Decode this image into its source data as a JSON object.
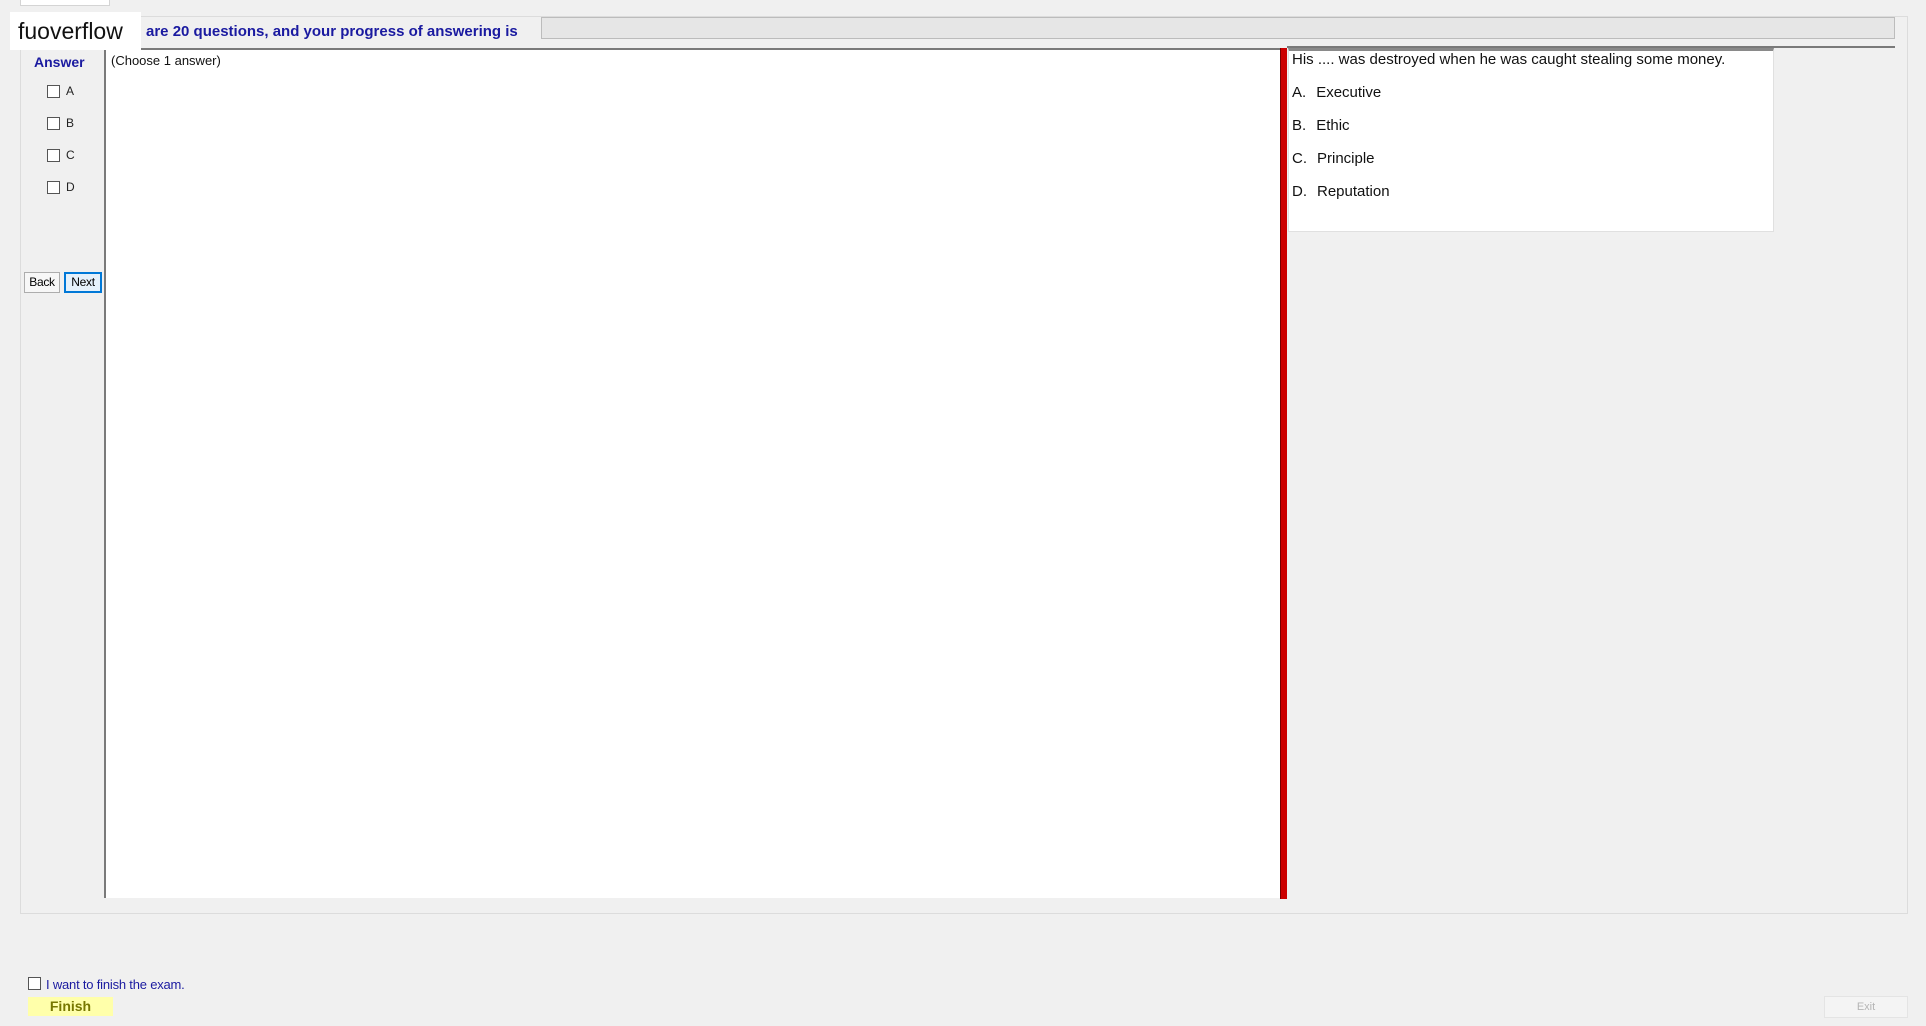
{
  "header": {
    "watermark": "fuoverflow",
    "progress_text": "are 20 questions, and your progress of answering is",
    "progress": 0
  },
  "answer_panel": {
    "title": "Answer",
    "choices": [
      {
        "label": "A",
        "checked": false
      },
      {
        "label": "B",
        "checked": false
      },
      {
        "label": "C",
        "checked": false
      },
      {
        "label": "D",
        "checked": false
      }
    ],
    "back_label": "Back",
    "next_label": "Next"
  },
  "answer_area": {
    "hint": "(Choose 1 answer)"
  },
  "question": {
    "text": "His .... was destroyed when he was caught stealing some money.",
    "options": [
      {
        "letter": "A.",
        "text": "Executive"
      },
      {
        "letter": "B.",
        "text": "Ethic"
      },
      {
        "letter": "C.",
        "text": "Principle"
      },
      {
        "letter": "D.",
        "text": "Reputation"
      }
    ]
  },
  "footer": {
    "finish_checkbox_label": "I want to finish the exam.",
    "finish_label": "Finish",
    "exit_label": "Exit"
  },
  "colors": {
    "accent_text": "#1a1aa0",
    "splitter": "#cc0000",
    "finish_bg": "#ffffaa"
  }
}
